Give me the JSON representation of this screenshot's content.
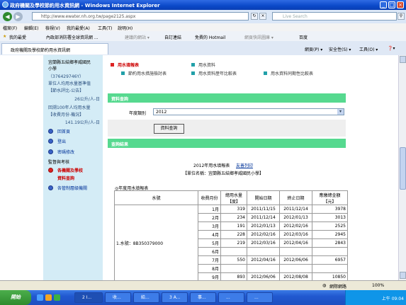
{
  "window": {
    "title": "政府機關及學校節約用水資訊網 - Windows Internet Explorer"
  },
  "address": {
    "url": "http://www.ewater.nh.org.tw/page2125.aspx",
    "search_placeholder": "Live Search"
  },
  "menu": [
    "檔案(F)",
    "編輯(E)",
    "檢視(V)",
    "我的最愛(A)",
    "工具(T)",
    "說明(H)"
  ],
  "favorites": {
    "label": "我的最愛",
    "items": [
      "內政部消防署全球資訊網 ...",
      "建議的網站 ▾",
      "自訂連結",
      "免費的 Hotmail",
      "網頁快訊圖庫 ▾",
      "百度"
    ]
  },
  "tab": {
    "label": "政府機關及學校節約用水資訊網"
  },
  "toolbar": {
    "page": "網頁(P) ▾",
    "security": "安全性(S) ▾",
    "tools": "工具(O) ▾",
    "help": "❓▾"
  },
  "sidebar": {
    "lines": [
      "宜蘭縣五結鄉孝威國民",
      "小學",
      "（376429746Y）",
      "單位人均用水量基準值",
      "【節水評比-公告】",
      "26公升/人-日",
      "回溯100年人均用水量",
      "【收費月份-機況】",
      "141.19公升/人-日"
    ],
    "links": [
      "回首頁",
      "登出",
      "密碼修改"
    ],
    "section": "監督與考核",
    "red_link": [
      "各機關及學校",
      "資料查詢"
    ],
    "last_link": "各管制層級機關"
  },
  "mainnav": {
    "active": "用水填報表",
    "items": [
      "用水資料",
      "節約用水措施檢討表",
      "用水資料歷年比較表",
      "用水資料同期性比較表"
    ]
  },
  "query": {
    "section_title": "資料查詢",
    "year_label": "年度類別",
    "year_value": "2012",
    "submit_label": "資料查詢"
  },
  "results": {
    "section_title": "查詢結果",
    "report_title": "2012年用水填報表",
    "print_link": "友善列印",
    "unit_name": "【單位名稱：宜蘭縣五結鄉孝威國民小學】",
    "table_title": "◎年度用水填報表",
    "headers": [
      "水號",
      "收費月份",
      "總用水量【度】",
      "開始日期",
      "終止日期",
      "應繳總金額【元】"
    ],
    "meter": "1.水號：8B350379000",
    "rows": [
      [
        "1月",
        "319",
        "2011/11/15",
        "2011/12/14",
        "3978"
      ],
      [
        "2月",
        "234",
        "2011/12/14",
        "2012/01/13",
        "3013"
      ],
      [
        "3月",
        "191",
        "2012/01/13",
        "2012/02/16",
        "2525"
      ],
      [
        "4月",
        "228",
        "2012/02/16",
        "2012/03/16",
        "2945"
      ],
      [
        "5月",
        "219",
        "2012/03/16",
        "2012/04/16",
        "2843"
      ],
      [
        "6月",
        "",
        "",
        "",
        ""
      ],
      [
        "7月",
        "550",
        "2012/04/16",
        "2012/06/06",
        "6957"
      ],
      [
        "8月",
        "",
        "",
        "",
        ""
      ],
      [
        "9月",
        "893",
        "2012/06/06",
        "2012/08/08",
        "10850"
      ]
    ]
  },
  "status": {
    "zone": "網際網路",
    "zoom": "100%"
  },
  "taskbar": {
    "start": "開始",
    "buttons": [
      "2 I...",
      "收...",
      "給...",
      "3 A...",
      "事...",
      "...",
      "..."
    ],
    "clock": "上午 09:04"
  }
}
